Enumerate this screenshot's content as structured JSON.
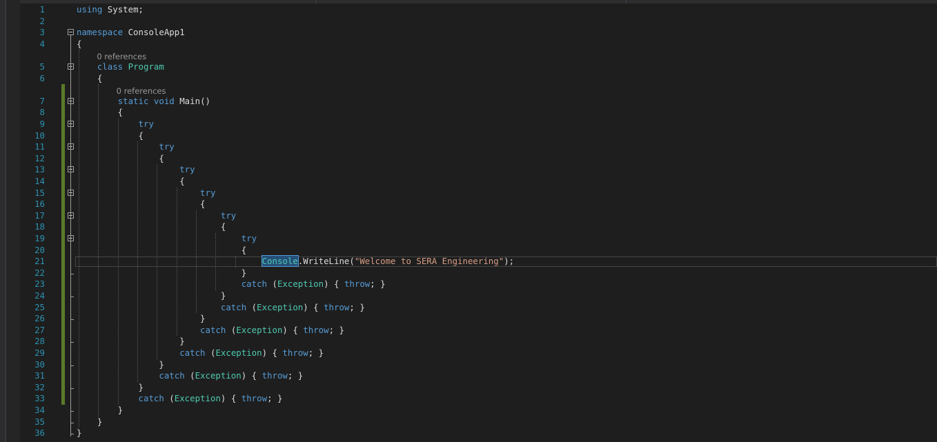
{
  "editor": {
    "lines": [
      {
        "n": "1",
        "tokens": [
          {
            "t": "using",
            "c": "kw"
          },
          {
            "t": " System;",
            "c": "pl"
          }
        ]
      },
      {
        "n": "2",
        "tokens": []
      },
      {
        "n": "3",
        "tokens": [
          {
            "t": "namespace",
            "c": "kw"
          },
          {
            "t": " ConsoleApp1",
            "c": "pl"
          }
        ]
      },
      {
        "n": "4",
        "tokens": [
          {
            "t": "{",
            "c": "pl"
          }
        ]
      },
      {
        "n": "5",
        "tokens": [
          {
            "t": "    ",
            "c": "pl"
          },
          {
            "t": "class",
            "c": "kw"
          },
          {
            "t": " ",
            "c": "pl"
          },
          {
            "t": "Program",
            "c": "ty"
          }
        ],
        "lens": "0 references"
      },
      {
        "n": "6",
        "tokens": [
          {
            "t": "    {",
            "c": "pl"
          }
        ]
      },
      {
        "n": "7",
        "tokens": [
          {
            "t": "        ",
            "c": "pl"
          },
          {
            "t": "static",
            "c": "kw"
          },
          {
            "t": " ",
            "c": "pl"
          },
          {
            "t": "void",
            "c": "kw"
          },
          {
            "t": " Main()",
            "c": "pl"
          }
        ],
        "lens": "0 references"
      },
      {
        "n": "8",
        "tokens": [
          {
            "t": "        {",
            "c": "pl"
          }
        ]
      },
      {
        "n": "9",
        "tokens": [
          {
            "t": "            ",
            "c": "pl"
          },
          {
            "t": "try",
            "c": "kw"
          }
        ]
      },
      {
        "n": "10",
        "tokens": [
          {
            "t": "            {",
            "c": "pl"
          }
        ]
      },
      {
        "n": "11",
        "tokens": [
          {
            "t": "                ",
            "c": "pl"
          },
          {
            "t": "try",
            "c": "kw"
          }
        ]
      },
      {
        "n": "12",
        "tokens": [
          {
            "t": "                {",
            "c": "pl"
          }
        ]
      },
      {
        "n": "13",
        "tokens": [
          {
            "t": "                    ",
            "c": "pl"
          },
          {
            "t": "try",
            "c": "kw"
          }
        ]
      },
      {
        "n": "14",
        "tokens": [
          {
            "t": "                    {",
            "c": "pl"
          }
        ]
      },
      {
        "n": "15",
        "tokens": [
          {
            "t": "                        ",
            "c": "pl"
          },
          {
            "t": "try",
            "c": "kw"
          }
        ]
      },
      {
        "n": "16",
        "tokens": [
          {
            "t": "                        {",
            "c": "pl"
          }
        ]
      },
      {
        "n": "17",
        "tokens": [
          {
            "t": "                            ",
            "c": "pl"
          },
          {
            "t": "try",
            "c": "kw"
          }
        ]
      },
      {
        "n": "18",
        "tokens": [
          {
            "t": "                            {",
            "c": "pl"
          }
        ]
      },
      {
        "n": "19",
        "tokens": [
          {
            "t": "                                ",
            "c": "pl"
          },
          {
            "t": "try",
            "c": "kw"
          }
        ]
      },
      {
        "n": "20",
        "tokens": [
          {
            "t": "                                {",
            "c": "pl"
          }
        ]
      },
      {
        "n": "21",
        "tokens": [
          {
            "t": "                                    ",
            "c": "pl"
          },
          {
            "t": "Console",
            "c": "ty sel"
          },
          {
            "t": ".WriteLine(",
            "c": "pl"
          },
          {
            "t": "\"Welcome to SERA Engineering\"",
            "c": "str"
          },
          {
            "t": ");",
            "c": "pl"
          }
        ]
      },
      {
        "n": "22",
        "tokens": [
          {
            "t": "                                }",
            "c": "pl"
          }
        ]
      },
      {
        "n": "23",
        "tokens": [
          {
            "t": "                                ",
            "c": "pl"
          },
          {
            "t": "catch",
            "c": "kw"
          },
          {
            "t": " (",
            "c": "pl"
          },
          {
            "t": "Exception",
            "c": "ty"
          },
          {
            "t": ") { ",
            "c": "pl"
          },
          {
            "t": "throw",
            "c": "kw"
          },
          {
            "t": "; }",
            "c": "pl"
          }
        ]
      },
      {
        "n": "24",
        "tokens": [
          {
            "t": "                            }",
            "c": "pl"
          }
        ]
      },
      {
        "n": "25",
        "tokens": [
          {
            "t": "                            ",
            "c": "pl"
          },
          {
            "t": "catch",
            "c": "kw"
          },
          {
            "t": " (",
            "c": "pl"
          },
          {
            "t": "Exception",
            "c": "ty"
          },
          {
            "t": ") { ",
            "c": "pl"
          },
          {
            "t": "throw",
            "c": "kw"
          },
          {
            "t": "; }",
            "c": "pl"
          }
        ]
      },
      {
        "n": "26",
        "tokens": [
          {
            "t": "                        }",
            "c": "pl"
          }
        ]
      },
      {
        "n": "27",
        "tokens": [
          {
            "t": "                        ",
            "c": "pl"
          },
          {
            "t": "catch",
            "c": "kw"
          },
          {
            "t": " (",
            "c": "pl"
          },
          {
            "t": "Exception",
            "c": "ty"
          },
          {
            "t": ") { ",
            "c": "pl"
          },
          {
            "t": "throw",
            "c": "kw"
          },
          {
            "t": "; }",
            "c": "pl"
          }
        ]
      },
      {
        "n": "28",
        "tokens": [
          {
            "t": "                    }",
            "c": "pl"
          }
        ]
      },
      {
        "n": "29",
        "tokens": [
          {
            "t": "                    ",
            "c": "pl"
          },
          {
            "t": "catch",
            "c": "kw"
          },
          {
            "t": " (",
            "c": "pl"
          },
          {
            "t": "Exception",
            "c": "ty"
          },
          {
            "t": ") { ",
            "c": "pl"
          },
          {
            "t": "throw",
            "c": "kw"
          },
          {
            "t": "; }",
            "c": "pl"
          }
        ]
      },
      {
        "n": "30",
        "tokens": [
          {
            "t": "                }",
            "c": "pl"
          }
        ]
      },
      {
        "n": "31",
        "tokens": [
          {
            "t": "                ",
            "c": "pl"
          },
          {
            "t": "catch",
            "c": "kw"
          },
          {
            "t": " (",
            "c": "pl"
          },
          {
            "t": "Exception",
            "c": "ty"
          },
          {
            "t": ") { ",
            "c": "pl"
          },
          {
            "t": "throw",
            "c": "kw"
          },
          {
            "t": "; }",
            "c": "pl"
          }
        ]
      },
      {
        "n": "32",
        "tokens": [
          {
            "t": "            }",
            "c": "pl"
          }
        ]
      },
      {
        "n": "33",
        "tokens": [
          {
            "t": "            ",
            "c": "pl"
          },
          {
            "t": "catch",
            "c": "kw"
          },
          {
            "t": " (",
            "c": "pl"
          },
          {
            "t": "Exception",
            "c": "ty"
          },
          {
            "t": ") { ",
            "c": "pl"
          },
          {
            "t": "throw",
            "c": "kw"
          },
          {
            "t": "; }",
            "c": "pl"
          }
        ]
      },
      {
        "n": "34",
        "tokens": [
          {
            "t": "        }",
            "c": "pl"
          }
        ]
      },
      {
        "n": "35",
        "tokens": [
          {
            "t": "    }",
            "c": "pl"
          }
        ]
      },
      {
        "n": "36",
        "tokens": [
          {
            "t": "}",
            "c": "pl"
          }
        ]
      }
    ],
    "colors": {
      "background": "#1e1e1e",
      "keyword": "#569cd6",
      "type": "#4ec9b0",
      "string": "#d69d85",
      "line_number": "#2b91af",
      "change_marker": "#5a7a2a"
    }
  }
}
